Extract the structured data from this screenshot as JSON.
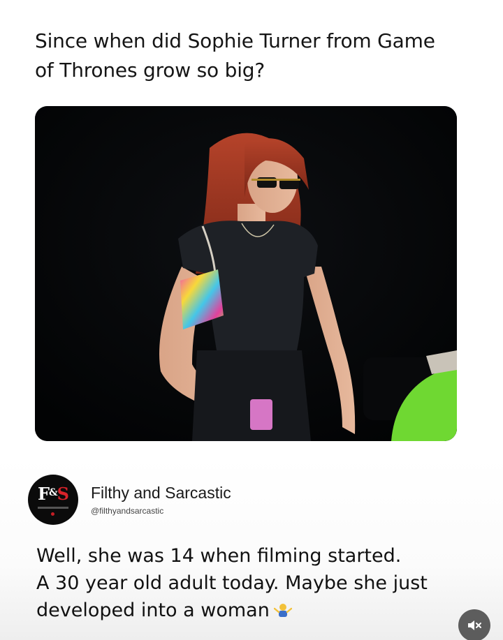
{
  "post": {
    "title": "Since when did Sophie Turner from Game of Thrones grow so big?"
  },
  "photo": {
    "icon": "photo-of-woman-in-black-outfit-with-colorful-bag"
  },
  "tweet": {
    "account_name": "Filthy and Sarcastic",
    "account_handle": "@filthyandsarcastic",
    "avatar": {
      "logo_left": "F",
      "logo_amp": "&",
      "logo_right": "S"
    },
    "lines": [
      "Well, she was 14 when filming started.",
      "A 30 year old adult today. Maybe she just",
      "developed into a woman"
    ],
    "emoji": "shrug-emoji"
  },
  "controls": {
    "mute_icon": "muted-speaker-icon"
  },
  "colors": {
    "background": "#ffffff",
    "text": "#111111",
    "logo_red": "#d8232a",
    "mute_bg": "#3c3c3c"
  }
}
